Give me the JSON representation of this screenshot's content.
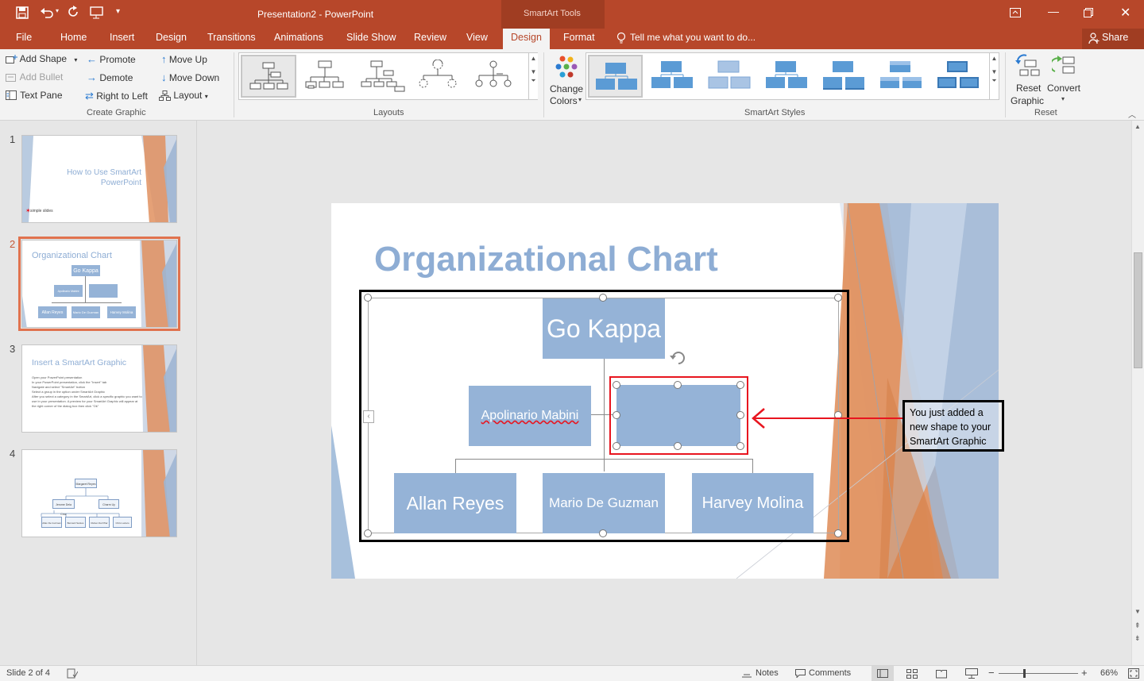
{
  "titlebar": {
    "doc_title": "Presentation2 - PowerPoint",
    "context_tab": "SmartArt Tools",
    "share_label": "Share"
  },
  "tabs": [
    "File",
    "Home",
    "Insert",
    "Design",
    "Transitions",
    "Animations",
    "Slide Show",
    "Review",
    "View",
    "Design",
    "Format"
  ],
  "tell_me": "Tell me what you want to do...",
  "ribbon": {
    "create_graphic": {
      "add_shape": "Add Shape",
      "add_bullet": "Add Bullet",
      "text_pane": "Text Pane",
      "promote": "Promote",
      "demote": "Demote",
      "right_to_left": "Right to Left",
      "move_up": "Move Up",
      "move_down": "Move Down",
      "layout": "Layout",
      "group_label": "Create Graphic"
    },
    "layouts_label": "Layouts",
    "change_colors": "Change",
    "change_colors_2": "Colors",
    "smartart_styles_label": "SmartArt Styles",
    "reset_graphic": "Reset",
    "reset_graphic_2": "Graphic",
    "convert": "Convert",
    "reset_label": "Reset"
  },
  "thumbnails": [
    {
      "num": "1",
      "title": "How to Use SmartArt PowerPoint",
      "brand": "simple slides"
    },
    {
      "num": "2",
      "title": "Organizational Chart",
      "top": "Go Kappa",
      "mid": "Apolinario Mabini",
      "b1": "Allan Reyes",
      "b2": "Mario De Guzman",
      "b3": "Harvey Molina"
    },
    {
      "num": "3",
      "title": "Insert a SmartArt Graphic",
      "bullets": [
        "Open your PowerPoint presentation",
        "In your PowerPoint presentation, click the \"Insert\" tab",
        "Navigate and select \"SmartArt\" button",
        "Select a group in the option under SmartArt Graphic",
        "After you select a category in the SmartArt, click a specific graphic you want to use in your presentation. A preview for your SmartArt Graphic will appear at the right corner of the dialog box then click \"Ok\""
      ]
    },
    {
      "num": "4",
      "nodes": [
        "Margaret Reyes",
        "Jerome Dela Cruz",
        "Charm Uy",
        "Allan De Guzman",
        "Bernard Santos",
        "Ruben Del Pilar",
        "Chris Lazaro"
      ]
    }
  ],
  "slide": {
    "title": "Organizational Chart",
    "top_box": "Go Kappa",
    "left_box": "Apolinario Mabini",
    "new_box": "",
    "bottom_boxes": [
      "Allan Reyes",
      "Mario De Guzman",
      "Harvey Molina"
    ],
    "callout": "You just added a new shape to your SmartArt Graphic"
  },
  "status": {
    "slide_info": "Slide 2 of 4",
    "notes": "Notes",
    "comments": "Comments",
    "zoom": "66%"
  },
  "colors": {
    "accent": "#b7472a",
    "box_fill": "#95b3d7",
    "title_blue": "#8eadd4",
    "callout_red": "#e8151f"
  }
}
